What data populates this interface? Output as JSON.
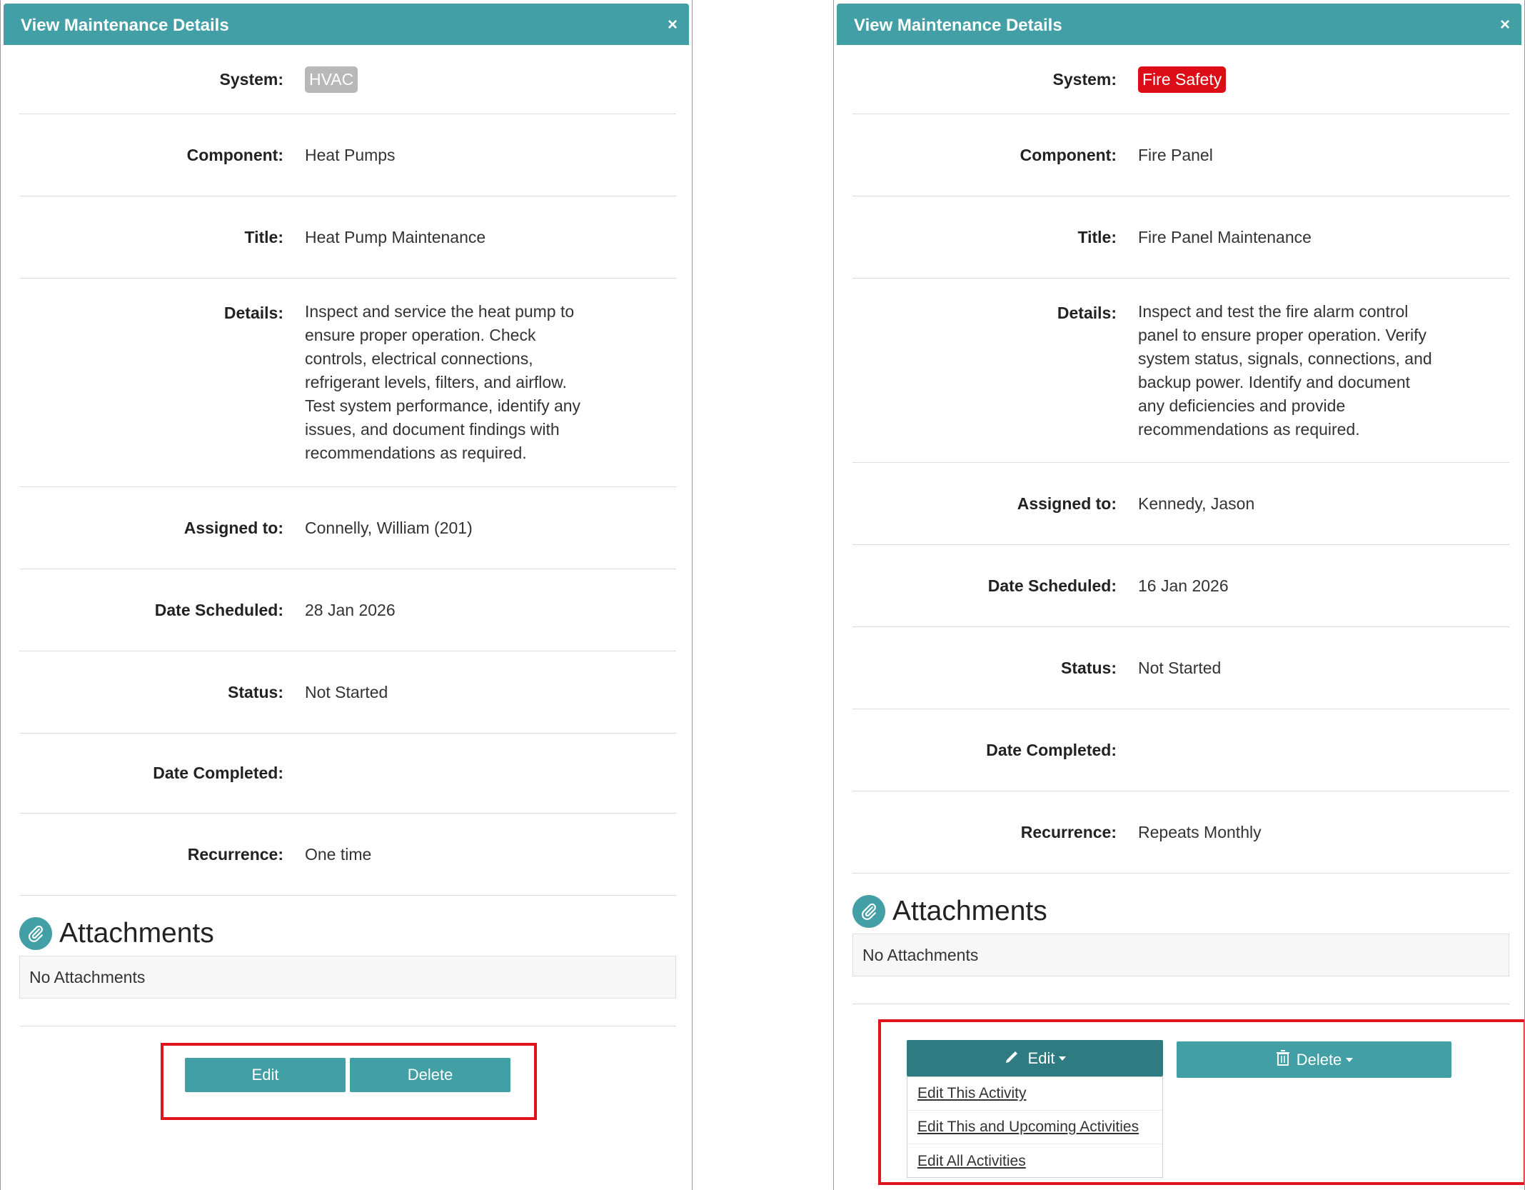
{
  "left": {
    "header": {
      "title": "View Maintenance Details",
      "close": "×"
    },
    "labels": {
      "system": "System:",
      "component": "Component:",
      "title": "Title:",
      "details": "Details:",
      "assigned": "Assigned to:",
      "date_scheduled": "Date Scheduled:",
      "status": "Status:",
      "date_completed": "Date Completed:",
      "recurrence": "Recurrence:"
    },
    "values": {
      "system": "HVAC",
      "system_color": "#b8b8b8",
      "component": "Heat Pumps",
      "title": "Heat Pump Maintenance",
      "details_lines": [
        "Inspect and service the heat pump to",
        "ensure proper operation. Check",
        "controls, electrical connections,",
        "refrigerant levels, filters, and airflow.",
        "Test system performance, identify any",
        "issues, and document findings with",
        "recommendations as required."
      ],
      "assigned": "Connelly, William (201)",
      "date_scheduled": "28 Jan 2026",
      "status": "Not Started",
      "date_completed": "",
      "recurrence": "One time"
    },
    "attachments": {
      "title": "Attachments",
      "empty": "No Attachments",
      "icon": "paperclip-icon"
    },
    "buttons": {
      "edit": "Edit",
      "delete": "Delete"
    }
  },
  "right": {
    "header": {
      "title": "View Maintenance Details",
      "close": "×"
    },
    "labels": {
      "system": "System:",
      "component": "Component:",
      "title": "Title:",
      "details": "Details:",
      "assigned": "Assigned to:",
      "date_scheduled": "Date Scheduled:",
      "status": "Status:",
      "date_completed": "Date Completed:",
      "recurrence": "Recurrence:"
    },
    "values": {
      "system": "Fire Safety",
      "system_color": "#dd0d17",
      "component": "Fire Panel",
      "title": "Fire Panel Maintenance",
      "details_lines": [
        "Inspect and test the fire alarm control",
        "panel to ensure proper operation. Verify",
        "system status, signals, connections, and",
        "backup power. Identify and document",
        "any deficiencies and provide",
        "recommendations as required."
      ],
      "assigned": "Kennedy, Jason",
      "date_scheduled": "16 Jan 2026",
      "status": "Not Started",
      "date_completed": "",
      "recurrence": "Repeats Monthly"
    },
    "attachments": {
      "title": "Attachments",
      "empty": "No Attachments",
      "icon": "paperclip-icon"
    },
    "buttons": {
      "edit": "Edit",
      "delete": "Delete",
      "edit_icon": "pencil-icon",
      "delete_icon": "trash-icon"
    },
    "edit_menu": [
      "Edit This Activity",
      "Edit This and Upcoming Activities",
      "Edit All Activities"
    ]
  },
  "colors": {
    "accent": "#429fa5",
    "accent_dark": "#2e7c82",
    "highlight": "#e0141b"
  }
}
